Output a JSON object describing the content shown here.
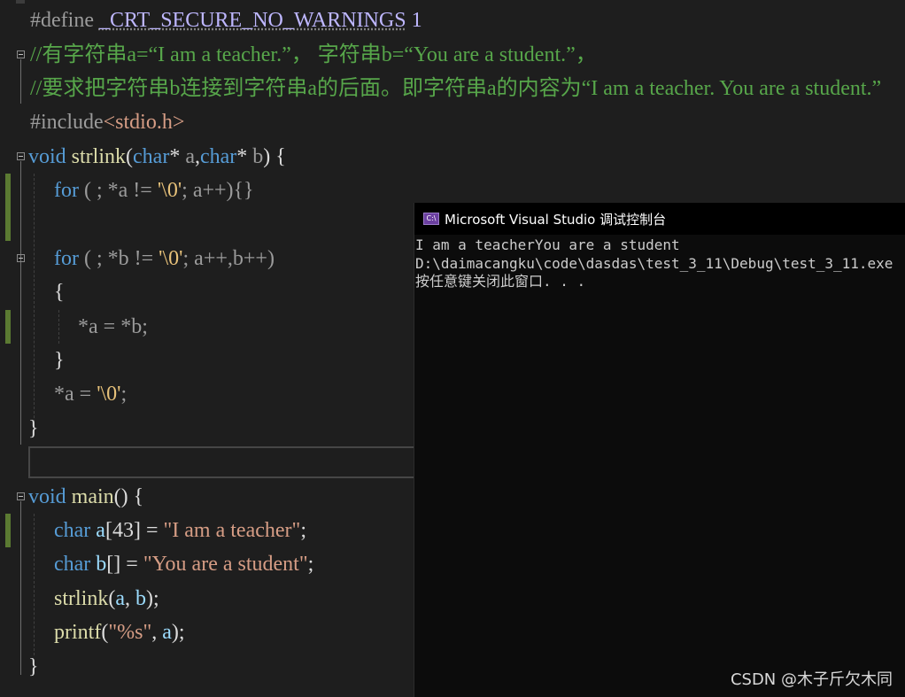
{
  "editor": {
    "lines": {
      "l1": {
        "p1": "#define ",
        "p2": "_CRT_SECURE_NO_WARNINGS",
        "p3": " 1"
      },
      "l2": "//有字符串a=“I am a teacher.”， 字符串b=“You are a student.”，",
      "l3": "//要求把字符串b连接到字符串a的后面。即字符串a的内容为“I am a teacher. You are a student.”",
      "l4": {
        "p1": "#include",
        "p2": "<stdio.h>"
      },
      "l5": {
        "kw1": "void",
        "fn": " strlink",
        "p1": "(",
        "kw2": "char",
        "p2": "* ",
        "a": "a",
        "p3": ",",
        "kw3": "char",
        "p4": "* ",
        "b": "b",
        "p5": ") {"
      },
      "l6": {
        "kw": "for",
        "p1": " ( ;  *a != ",
        "chr": "'\\0'",
        "p2": "; a++){}"
      },
      "l7": {
        "kw": "for",
        "p1": " ( ; *b != ",
        "chr": "'\\0'",
        "p2": "; a++,b++)"
      },
      "l8": "{",
      "l9": "*a = *b;",
      "l10": "}",
      "l11": {
        "p1": "*a = ",
        "chr": "'\\0'",
        "p2": ";"
      },
      "l12": "}",
      "l13": {
        "kw": "void",
        "fn": " main",
        "p1": "() {"
      },
      "l14": {
        "kw": "char",
        "id": " a",
        "p1": "[43] = ",
        "str": "\"I am a teacher\"",
        "p2": ";"
      },
      "l15": {
        "kw": "char",
        "id": " b",
        "p1": "[] = ",
        "str": "\"You are a student\"",
        "p2": ";"
      },
      "l16": {
        "fn": "strlink",
        "p1": "(",
        "a": "a",
        "p2": ", ",
        "b": "b",
        "p3": ");"
      },
      "l17": {
        "fn": "printf",
        "p1": "(",
        "str": "\"%s\"",
        "p2": ", ",
        "a": "a",
        "p3": ");"
      },
      "l18": "}"
    }
  },
  "console": {
    "title": "Microsoft Visual Studio 调试控制台",
    "icon_text": "C:\\",
    "output": [
      "I am a teacherYou are a student",
      "D:\\daimacangku\\code\\dasdas\\test_3_11\\Debug\\test_3_11.exe",
      "按任意键关闭此窗口. . ."
    ]
  },
  "watermark": "CSDN @木子斤欠木同",
  "colors": {
    "editor_bg": "#1e1e1e",
    "console_bg": "#0c0c0c",
    "keyword": "#569cd6",
    "function": "#dcdcaa",
    "string": "#d69d85",
    "comment": "#57a64a"
  }
}
